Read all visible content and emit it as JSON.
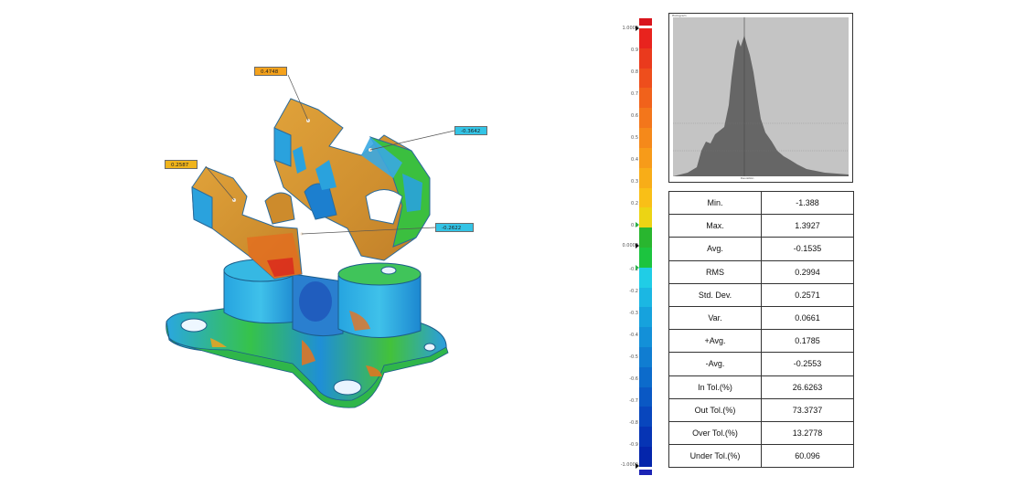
{
  "callouts": [
    {
      "id": "c1",
      "value": "0.4748",
      "color": "#f5a21b"
    },
    {
      "id": "c2",
      "value": "-0.3642",
      "color": "#33c4e6"
    },
    {
      "id": "c3",
      "value": "0.2587",
      "color": "#f0b41c"
    },
    {
      "id": "c4",
      "value": "-0.2622",
      "color": "#33c4e6"
    }
  ],
  "colorbar": {
    "top_value": "1.0000",
    "zero_value": "0.0000",
    "bottom_value": "-1.0000",
    "ticks": [
      "0.9",
      "0.8",
      "0.7",
      "0.6",
      "0.5",
      "0.4",
      "0.3",
      "0.2",
      "0.1",
      "-0.1",
      "-0.2",
      "-0.3",
      "-0.4",
      "-0.5",
      "-0.6",
      "-0.7",
      "-0.8",
      "-0.9"
    ],
    "colors": [
      "#e8231e",
      "#ea3a1d",
      "#ee4e1c",
      "#f1621b",
      "#f3761b",
      "#f5891a",
      "#f79b19",
      "#f8ad18",
      "#f9bf17",
      "#ecd414",
      "#29b62f",
      "#1cc43f",
      "#20cde6",
      "#1bb7e3",
      "#16a2dd",
      "#1390d8",
      "#107dd1",
      "#0c6bcb",
      "#0a58c4",
      "#0846bd",
      "#0634b4",
      "#0425ab"
    ],
    "over_color": "#d9141c",
    "under_color": "#1b24b5"
  },
  "histogram": {
    "title": "Histogram",
    "x_label": "Deviation"
  },
  "stats": [
    {
      "label": "Min.",
      "value": "-1.388"
    },
    {
      "label": "Max.",
      "value": "1.3927"
    },
    {
      "label": "Avg.",
      "value": "-0.1535"
    },
    {
      "label": "RMS",
      "value": "0.2994"
    },
    {
      "label": "Std. Dev.",
      "value": "0.2571"
    },
    {
      "label": "Var.",
      "value": "0.0661"
    },
    {
      "label": "+Avg.",
      "value": "0.1785"
    },
    {
      "label": "-Avg.",
      "value": "-0.2553"
    },
    {
      "label": "In Tol.(%)",
      "value": "26.6263"
    },
    {
      "label": "Out Tol.(%)",
      "value": "73.3737"
    },
    {
      "label": "Over Tol.(%)",
      "value": "13.2778"
    },
    {
      "label": "Under Tol.(%)",
      "value": "60.096"
    }
  ]
}
